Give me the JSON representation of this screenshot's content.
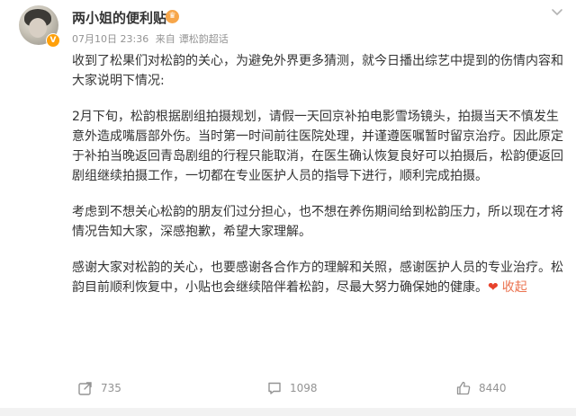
{
  "post": {
    "author": "两小姐的便利贴",
    "timestamp": "07月10日 23:36",
    "source_prefix": "来自",
    "source": "谭松韵超话",
    "paragraphs": [
      "收到了松果们对松韵的关心，为避免外界更多猜测，就今日播出综艺中提到的伤情内容和大家说明下情况:",
      "2月下旬，松韵根据剧组拍摄规划，请假一天回京补拍电影雪场镜头，拍摄当天不慎发生意外造成嘴唇部外伤。当时第一时间前往医院处理，并谨遵医嘱暂时留京治疗。因此原定于补拍当晚返回青岛剧组的行程只能取消，在医生确认恢复良好可以拍摄后，松韵便返回剧组继续拍摄工作，一切都在专业医护人员的指导下进行，顺利完成拍摄。",
      "考虑到不想关心松韵的朋友们过分担心，也不想在养伤期间给到松韵压力，所以现在才将情况告知大家，深感抱歉，希望大家理解。",
      "感谢大家对松韵的关心，也要感谢各合作方的理解和关照，感谢医护人员的专业治疗。松韵目前顺利恢复中，小贴也会继续陪伴着松韵，尽最大努力确保她的健康。"
    ],
    "heart": "❤",
    "collapse_label": "收起"
  },
  "actions": {
    "forward_count": "735",
    "comment_count": "1098",
    "like_count": "8440"
  },
  "icons": {
    "verified": "verified-badge-icon",
    "vip": "vip-level-icon",
    "more": "chevron-down-icon",
    "forward": "forward-icon",
    "comment": "comment-icon",
    "like": "like-icon"
  },
  "colors": {
    "accent": "#eb7350",
    "heart": "#e8422c",
    "muted": "#939393"
  }
}
